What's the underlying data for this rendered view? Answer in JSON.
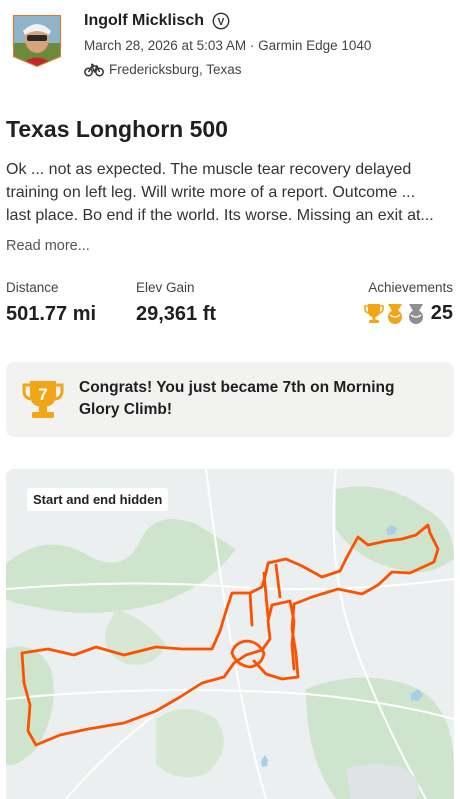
{
  "header": {
    "athlete_name": "Ingolf Micklisch",
    "subscriber_badge": "V",
    "datetime_device": "March 28, 2026 at 5:03 AM · Garmin Edge 1040",
    "location": "Fredericksburg, Texas",
    "activity_icon": "bike-icon"
  },
  "activity": {
    "title": "Texas Longhorn 500",
    "description_lines": [
      "Ok ... not as expected. The muscle tear recovery delayed",
      "training on left leg.   Will write more of a report. Outcome ...",
      "last place. Bo end if the world. Its worse. Missing an exit at..."
    ],
    "read_more": "Read more..."
  },
  "stats": {
    "distance_label": "Distance",
    "distance_value": "501.77 mi",
    "elev_label": "Elev Gain",
    "elev_value": "29,361 ft",
    "achievements_label": "Achievements",
    "achievements_count": "25",
    "achievement_icons": [
      "gold-trophy-icon",
      "gold-medal-icon",
      "grey-medal-icon"
    ]
  },
  "congrats": {
    "rank_number": "7",
    "message": "Congrats! You just became 7th on Morning Glory Climb!"
  },
  "map": {
    "badge": "Start and end hidden",
    "route_color": "#fc5200"
  },
  "colors": {
    "gold": "#f2a516",
    "silver": "#8f8f8f",
    "brand_orange": "#fc5200"
  }
}
